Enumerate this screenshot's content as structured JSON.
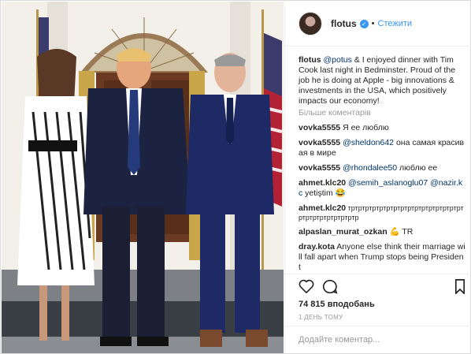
{
  "post": {
    "header": {
      "username": "flotus",
      "verified": true,
      "separator": "•",
      "follow_label": "Стежити"
    },
    "caption": {
      "username": "flotus",
      "mention": "@potus",
      "text": "& I enjoyed dinner with Tim Cook last night in Bedminster. Proud of the job he is doing at Apple - big innovations & investments in the USA, which positively impacts our economy!"
    },
    "more_comments_label": "Більше коментарів",
    "comments": [
      {
        "username": "vovka5555",
        "mention": "",
        "text": "Я ее люблю"
      },
      {
        "username": "vovka5555",
        "mention": "@sheldon642",
        "text": "она самая красивая в мире"
      },
      {
        "username": "vovka5555",
        "mention": "@rhondalee50",
        "text": "люблю ее"
      },
      {
        "username": "ahmet.klc20",
        "mention": "@semih_aslanoglu07 @nazir.kc",
        "text": "yetiştim 😂"
      },
      {
        "username": "ahmet.klc20",
        "mention": "",
        "text": "тртртртртртртртртртртртртртртртртртртртртртртртртр"
      },
      {
        "username": "alpaslan_murat_ozkan",
        "mention": "",
        "text": "💪 TR"
      },
      {
        "username": "dray.kota",
        "mention": "",
        "text": "Anyone else think their marriage will fall apart when Trump stops being President"
      }
    ],
    "likes": "74 815 вподобань",
    "timestamp": "1 ДЕНЬ ТОМУ",
    "add_comment_placeholder": "Додайте коментар..."
  },
  "icons": {
    "like": "heart-icon",
    "comment": "comment-icon",
    "save": "bookmark-icon",
    "verified": "verified-badge-icon"
  },
  "colors": {
    "link": "#3897f0",
    "mention": "#003569",
    "muted": "#999999",
    "border": "#efefef"
  }
}
